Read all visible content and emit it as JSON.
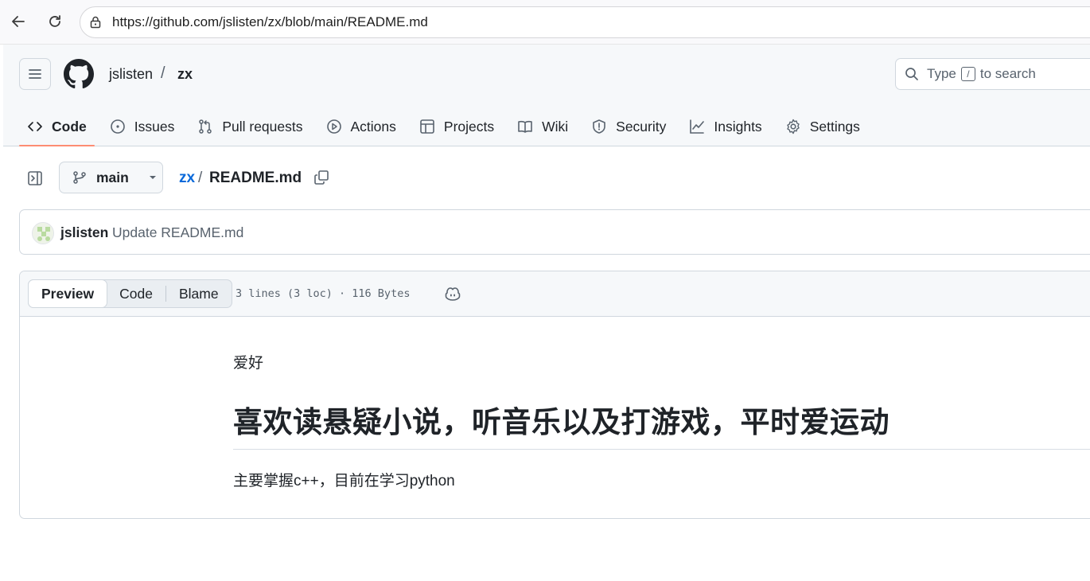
{
  "browser": {
    "url": "https://github.com/jslisten/zx/blob/main/README.md"
  },
  "header": {
    "owner": "jslisten",
    "separator": "/",
    "repo": "zx",
    "search_prefix": "Type",
    "search_key": "/",
    "search_suffix": "to search"
  },
  "tabs": [
    {
      "label": "Code",
      "icon": "code-icon"
    },
    {
      "label": "Issues",
      "icon": "issue-icon"
    },
    {
      "label": "Pull requests",
      "icon": "pull-request-icon"
    },
    {
      "label": "Actions",
      "icon": "play-icon"
    },
    {
      "label": "Projects",
      "icon": "table-icon"
    },
    {
      "label": "Wiki",
      "icon": "book-icon"
    },
    {
      "label": "Security",
      "icon": "shield-icon"
    },
    {
      "label": "Insights",
      "icon": "graph-icon"
    },
    {
      "label": "Settings",
      "icon": "gear-icon"
    }
  ],
  "file_path": {
    "branch": "main",
    "repo_link": "zx",
    "separator": "/",
    "file_name": "README.md"
  },
  "commit": {
    "author": "jslisten",
    "message": "Update README.md"
  },
  "file_view": {
    "modes": [
      "Preview",
      "Code",
      "Blame"
    ],
    "active_mode": "Preview",
    "meta": "3 lines (3 loc) · 116 Bytes"
  },
  "readme": {
    "line1": "爱好",
    "heading": "喜欢读悬疑小说，听音乐以及打游戏，平时爱运动",
    "line3": "主要掌握c++，目前在学习python"
  },
  "colors": {
    "link": "#0969da",
    "active_tab_underline": "#fd8c73",
    "border": "#d0d7de"
  }
}
